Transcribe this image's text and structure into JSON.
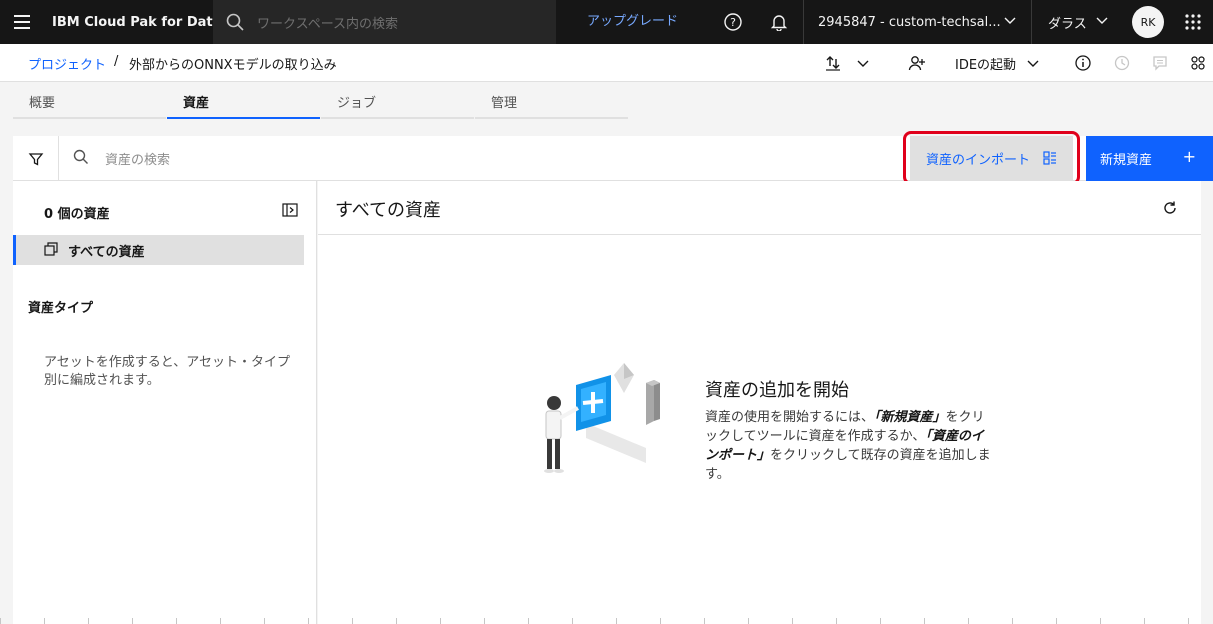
{
  "header": {
    "brand": "IBM Cloud Pak for Data",
    "search_placeholder": "ワークスペース内の検索",
    "upgrade": "アップグレード",
    "account": "2945847 - custom-techsal...",
    "region": "ダラス",
    "avatar_initials": "RK"
  },
  "breadcrumb": {
    "root": "プロジェクト",
    "separator": "/",
    "current": "外部からのONNXモデルの取り込み"
  },
  "toolbar_top": {
    "ide_launch": "IDEの起動"
  },
  "tabs": [
    {
      "label": "概要",
      "active": false
    },
    {
      "label": "資産",
      "active": true
    },
    {
      "label": "ジョブ",
      "active": false
    },
    {
      "label": "管理",
      "active": false
    }
  ],
  "asset_toolbar": {
    "search_placeholder": "資産の検索",
    "import_button": "資産のインポート",
    "new_button": "新規資産"
  },
  "left_panel": {
    "asset_count": "0 個の資産",
    "all_assets": "すべての資産",
    "asset_types_heading": "資産タイプ",
    "asset_types_help": "アセットを作成すると、アセット・タイプ別に編成されます。"
  },
  "main_panel": {
    "title": "すべての資産",
    "empty_title": "資産の追加を開始",
    "empty_body_1": "資産の使用を開始するには、",
    "empty_body_new": "「新規資産」",
    "empty_body_2": "をクリックしてツールに資産を作成するか、",
    "empty_body_import": "「資産のインポート」",
    "empty_body_3": "をクリックして既存の資産を追加します。"
  },
  "colors": {
    "accent": "#0f62fe",
    "header_bg": "#161616",
    "highlight": "#e0001b"
  },
  "icons": [
    "menu-icon",
    "search-icon",
    "help-icon",
    "notification-icon",
    "chevron-down-icon",
    "app-switcher-icon",
    "upload-icon",
    "add-user-icon",
    "info-icon",
    "history-icon",
    "comment-icon",
    "settings-icon",
    "filter-icon",
    "import-icon",
    "plus-icon",
    "collapse-panel-icon",
    "copy-icon",
    "refresh-icon"
  ]
}
